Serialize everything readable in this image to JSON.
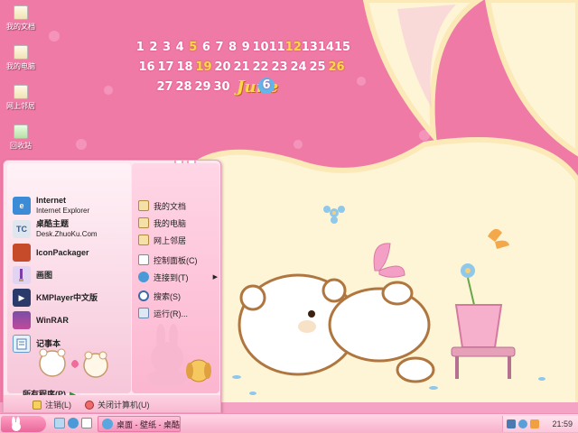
{
  "desktop": {
    "icons": [
      {
        "label": "我的文档"
      },
      {
        "label": "我的电脑"
      },
      {
        "label": "网上邻居"
      },
      {
        "label": "回收站"
      }
    ]
  },
  "calendar": {
    "rows": [
      [
        "1",
        "2",
        "3",
        "4",
        "5",
        "6",
        "7",
        "8",
        "9",
        "10",
        "11",
        "12",
        "13",
        "14",
        "15"
      ],
      [
        "16",
        "17",
        "18",
        "19",
        "20",
        "21",
        "22",
        "23",
        "24",
        "25",
        "26"
      ],
      [
        "27",
        "28",
        "29",
        "30"
      ]
    ],
    "highlighted_days": [
      "5",
      "12",
      "19",
      "26"
    ],
    "month": "June",
    "current_day": "6"
  },
  "start_menu": {
    "pinned": [
      {
        "title": "Internet",
        "subtitle": "Internet Explorer"
      },
      {
        "title": "桌酷主题",
        "subtitle": "Desk.ZhuoKu.Com"
      }
    ],
    "recent": [
      {
        "title": "IconPackager"
      },
      {
        "title": "画图"
      },
      {
        "title": "KMPlayer中文版"
      },
      {
        "title": "WinRAR"
      },
      {
        "title": "记事本"
      }
    ],
    "all_programs": "所有程序(P)",
    "right": [
      {
        "label": "我的文档"
      },
      {
        "label": "我的电脑"
      },
      {
        "label": "网上邻居"
      },
      {
        "label": "控制面板(C)"
      },
      {
        "label": "连接到(T)"
      },
      {
        "label": "搜索(S)"
      },
      {
        "label": "运行(R)..."
      }
    ],
    "logoff": "注销(L)",
    "shutdown": "关闭计算机(U)"
  },
  "taskbar": {
    "window_title": "桌面 - 壁纸 - 桌酷...",
    "clock": "21:59"
  },
  "colors": {
    "wallpaper_pink": "#f07aa6",
    "bunny_cream": "#fdf5d6",
    "calendar_highlight": "#ffd84a",
    "day_badge": "#5fb7ec"
  }
}
